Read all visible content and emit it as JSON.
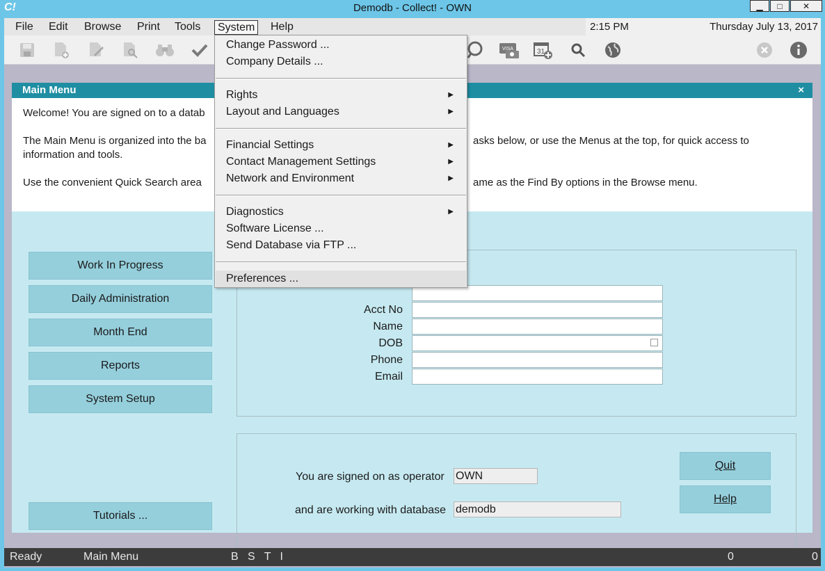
{
  "window": {
    "logo": "C!",
    "title": "Demodb - Collect! - OWN",
    "min": "▁",
    "max": "□",
    "close": "✕"
  },
  "menubar": {
    "items": [
      "File",
      "Edit",
      "Browse",
      "Print",
      "Tools",
      "System",
      "Help"
    ],
    "time": "2:15 PM",
    "date": "Thursday  July 13, 2017"
  },
  "toolbar": {
    "icons": [
      "save-icon",
      "new-document-icon",
      "edit-document-icon",
      "find-document-icon",
      "binoculars-icon",
      "checkmark-icon",
      "chat-bubble-icon",
      "visa-card-icon",
      "calendar-add-icon",
      "magnifier-icon",
      "globe-icon",
      "cancel-icon",
      "info-icon"
    ]
  },
  "system_menu": {
    "change_password": "Change Password ...",
    "company_details": "Company Details ...",
    "rights": "Rights",
    "layout_languages": "Layout and Languages",
    "financial_settings": "Financial Settings",
    "contact_mgmt": "Contact Management Settings",
    "network_env": "Network and Environment",
    "diagnostics": "Diagnostics",
    "software_license": "Software License ...",
    "send_db_ftp": "Send Database via FTP ...",
    "preferences": "Preferences ..."
  },
  "panel": {
    "title": "Main Menu",
    "close": "×",
    "welcome_1": "Welcome! You are signed on to a datab",
    "welcome_2a": "The Main Menu is organized into the ba",
    "welcome_2b": "asks below, or use the Menus at the top, for quick access to",
    "welcome_2c": "information and tools.",
    "welcome_3a": "Use the convenient Quick Search area",
    "welcome_3b": "ame as the Find By options in the Browse menu."
  },
  "side_buttons": {
    "wip": "Work In Progress",
    "daily": "Daily Administration",
    "month_end": "Month End",
    "reports": "Reports",
    "system_setup": "System Setup",
    "tutorials": "Tutorials ..."
  },
  "search": {
    "acct_no": "Acct No",
    "name": "Name",
    "dob": "DOB",
    "phone": "Phone",
    "email": "Email"
  },
  "info": {
    "operator_label": "You are signed on as operator",
    "operator_value": "OWN",
    "database_label": "and are working with database",
    "database_value": "demodb",
    "quit": "Quit",
    "help": "Help"
  },
  "statusbar": {
    "status": "Ready",
    "screen": "Main Menu",
    "flags": "B   S   T   I",
    "count1": "0",
    "count2": "0"
  }
}
